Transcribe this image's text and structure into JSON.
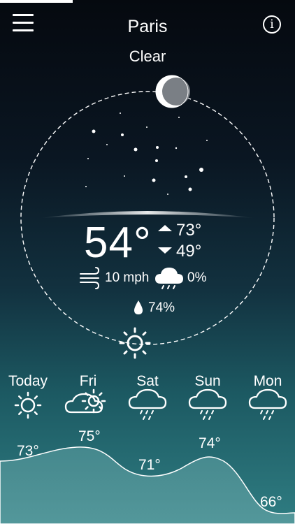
{
  "header": {
    "city": "Paris",
    "condition": "Clear"
  },
  "current": {
    "temperature": "54°",
    "high": "73°",
    "low": "49°",
    "wind": "10 mph",
    "precipitation": "0%",
    "humidity": "74%"
  },
  "forecast": {
    "days": [
      "Today",
      "Fri",
      "Sat",
      "Sun",
      "Mon"
    ],
    "icons": [
      "sun-icon",
      "partly-cloudy-icon",
      "rain-cloud-icon",
      "rain-cloud-icon",
      "rain-cloud-icon"
    ],
    "temps": [
      "73°",
      "75°",
      "71°",
      "74°",
      "66°"
    ]
  },
  "icons": {
    "menu": "menu-icon",
    "info": "info-icon",
    "moon": "moon-icon",
    "sun": "sun-icon",
    "wind": "wind-icon",
    "rain": "rain-cloud-icon",
    "humidity": "droplet-icon",
    "high": "up-arrow-icon",
    "low": "down-arrow-icon"
  },
  "colors": {
    "background_top": "#05090f",
    "background_bottom": "#2f7d82",
    "text": "#ffffff"
  }
}
